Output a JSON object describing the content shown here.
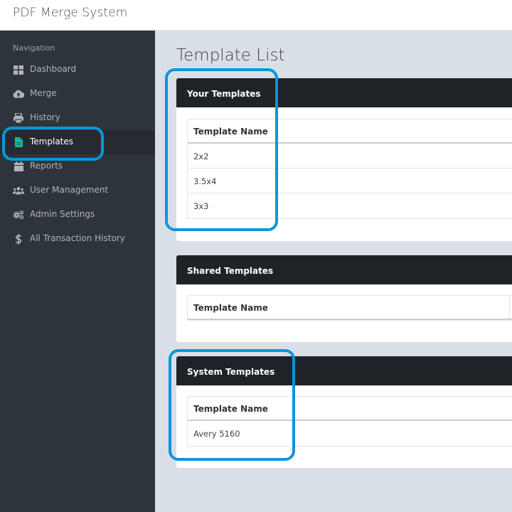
{
  "app": {
    "title": "PDF Merge System"
  },
  "sidebar": {
    "heading": "Navigation",
    "items": [
      {
        "label": "Dashboard",
        "icon": "dashboard-icon",
        "active": false
      },
      {
        "label": "Merge",
        "icon": "cloud-upload-icon",
        "active": false
      },
      {
        "label": "History",
        "icon": "printer-icon",
        "active": false
      },
      {
        "label": "Templates",
        "icon": "file-icon",
        "active": true
      },
      {
        "label": "Reports",
        "icon": "calendar-icon",
        "active": false
      },
      {
        "label": "User Management",
        "icon": "users-icon",
        "active": false
      },
      {
        "label": "Admin Settings",
        "icon": "gears-icon",
        "active": false
      },
      {
        "label": "All Transaction History",
        "icon": "dollar-icon",
        "active": false
      }
    ]
  },
  "main": {
    "title": "Template List",
    "sections": [
      {
        "title": "Your Templates",
        "column_header": "Template Name",
        "rows": [
          "2x2",
          "3.5x4",
          "3x3"
        ]
      },
      {
        "title": "Shared Templates",
        "column_header": "Template Name",
        "rows": []
      },
      {
        "title": "System Templates",
        "column_header": "Template Name",
        "rows": [
          "Avery 5160"
        ]
      }
    ]
  },
  "colors": {
    "accent_highlight": "#0a96d8",
    "active_icon": "#1fb39a",
    "sidebar_bg": "#2e343b",
    "card_header_bg": "#1f2328"
  }
}
